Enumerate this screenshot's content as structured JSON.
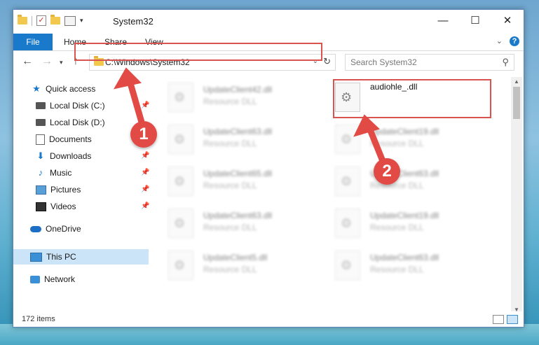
{
  "window": {
    "title": "System32",
    "controls": {
      "minimize": "—",
      "maximize": "☐",
      "close": "✕"
    }
  },
  "ribbon": {
    "tabs": [
      "File",
      "Home",
      "Share",
      "View"
    ]
  },
  "address": {
    "path": "C:\\Windows\\System32",
    "search_placeholder": "Search System32"
  },
  "sidebar": {
    "items": [
      {
        "label": "Quick access",
        "icon": "star-icon"
      },
      {
        "label": "Local Disk (C:)",
        "icon": "disk-icon",
        "pinned": true
      },
      {
        "label": "Local Disk (D:)",
        "icon": "disk-icon"
      },
      {
        "label": "Documents",
        "icon": "documents-icon"
      },
      {
        "label": "Downloads",
        "icon": "downloads-icon",
        "pinned": true
      },
      {
        "label": "Music",
        "icon": "music-icon",
        "pinned": true
      },
      {
        "label": "Pictures",
        "icon": "pictures-icon",
        "pinned": true
      },
      {
        "label": "Videos",
        "icon": "videos-icon",
        "pinned": true
      },
      {
        "label": "OneDrive",
        "icon": "cloud-icon"
      },
      {
        "label": "This PC",
        "icon": "computer-icon",
        "selected": true
      },
      {
        "label": "Network",
        "icon": "network-icon"
      }
    ]
  },
  "files": [
    {
      "name": "UpdateClient42.dll",
      "type": "Resource DLL"
    },
    {
      "name": "audiohle_.dll",
      "type": ""
    },
    {
      "name": "UpdateClient63.dll",
      "type": "Resource DLL"
    },
    {
      "name": "UpdateClient19.dll",
      "type": "Resource DLL"
    },
    {
      "name": "UpdateClient65.dll",
      "type": "Resource DLL"
    },
    {
      "name": "UpdateClient63.dll",
      "type": "Resource DLL"
    },
    {
      "name": "UpdateClient63.dll",
      "type": "Resource DLL"
    },
    {
      "name": "UpdateClient19.dll",
      "type": "Resource DLL"
    },
    {
      "name": "UpdateClient5.dll",
      "type": "Resource DLL"
    },
    {
      "name": "UpdateClient63.dll",
      "type": "Resource DLL"
    }
  ],
  "status": {
    "item_count": "172 items"
  },
  "annotations": {
    "step1": "1",
    "step2": "2",
    "color": "#e24a45"
  }
}
